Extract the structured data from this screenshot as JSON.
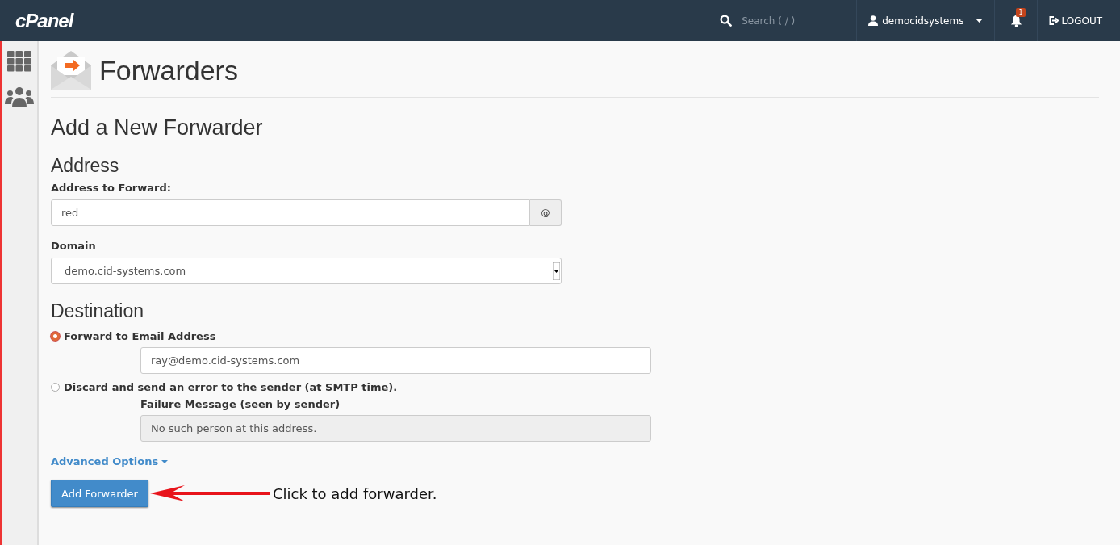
{
  "header": {
    "logo": "cPanel",
    "search": {
      "placeholder": "Search ( / )"
    },
    "user": "democidsystems",
    "notifications": "1",
    "logout": "LOGOUT"
  },
  "page": {
    "title": "Forwarders",
    "heading": "Add a New Forwarder"
  },
  "address": {
    "heading": "Address",
    "label": "Address to Forward:",
    "value": "red",
    "suffix": "@",
    "domain_label": "Domain",
    "domain": "demo.cid-systems.com"
  },
  "destination": {
    "heading": "Destination",
    "options": [
      {
        "kind": "email",
        "label": "Forward to Email Address",
        "selected": true,
        "value": "ray@demo.cid-systems.com"
      },
      {
        "kind": "fail",
        "label": "Discard and send an error to the sender (at SMTP time).",
        "selected": false,
        "field_label": "Failure Message (seen by sender)",
        "value": "No such person at this address."
      }
    ]
  },
  "advanced": "Advanced Options",
  "submit": "Add Forwarder",
  "annotation": "Click to add forwarder."
}
